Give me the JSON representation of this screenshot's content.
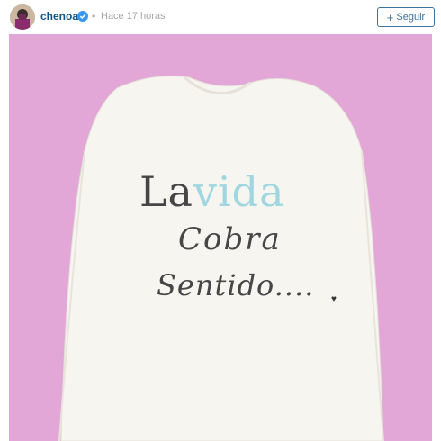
{
  "post": {
    "username": "chenoa",
    "verified": true,
    "separator": "•",
    "timestamp": "Hace 17 horas",
    "follow_label": "Seguir",
    "follow_icon": "plus-icon"
  },
  "photo": {
    "background_color": "#e2a7d7",
    "shirt_color": "#f7f5f0",
    "text": {
      "la": "La",
      "vida": "vida",
      "line2": "Cobra",
      "line3": "Sentido....",
      "heart": "♥"
    }
  },
  "colors": {
    "username": "#125688",
    "follow_border": "#3f729b",
    "vida_accent": "#9fd6e0"
  }
}
